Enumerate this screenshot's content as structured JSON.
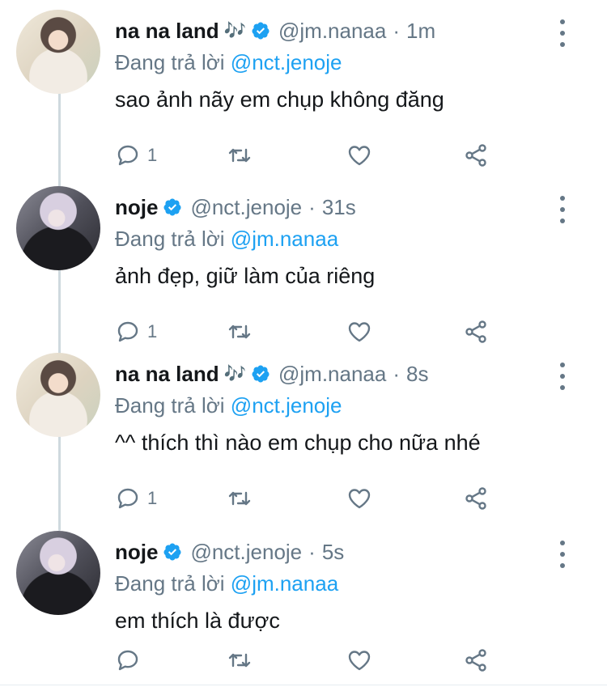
{
  "tweets": [
    {
      "avatar": "nana",
      "display_name": "na na land",
      "emoji": "🎶",
      "handle": "@jm.nanaa",
      "separator": "·",
      "time": "1m",
      "replying_prefix": "Đang trả lời",
      "replying_to": "@nct.jenoje",
      "text": "sao ảnh nãy em chụp không đăng",
      "reply_count": "1"
    },
    {
      "avatar": "noje",
      "display_name": "noje",
      "emoji": "",
      "handle": "@nct.jenoje",
      "separator": "·",
      "time": "31s",
      "replying_prefix": "Đang trả lời",
      "replying_to": "@jm.nanaa",
      "text": "ảnh đẹp, giữ làm của riêng",
      "reply_count": "1"
    },
    {
      "avatar": "nana",
      "display_name": "na na land",
      "emoji": "🎶",
      "handle": "@jm.nanaa",
      "separator": "·",
      "time": "8s",
      "replying_prefix": "Đang trả lời",
      "replying_to": "@nct.jenoje",
      "text": "^^ thích thì nào em chụp cho nữa nhé",
      "reply_count": "1"
    },
    {
      "avatar": "noje",
      "display_name": "noje",
      "emoji": "",
      "handle": "@nct.jenoje",
      "separator": "·",
      "time": "5s",
      "replying_prefix": "Đang trả lời",
      "replying_to": "@jm.nanaa",
      "text": "em thích là được",
      "reply_count": ""
    }
  ],
  "colors": {
    "link": "#1da1f2",
    "verified": "#1da1f2",
    "muted": "#657786",
    "thread_line": "#cfd9de"
  },
  "icons": [
    "verified-badge-icon",
    "more-icon",
    "reply-icon",
    "retweet-icon",
    "like-icon",
    "share-icon"
  ]
}
